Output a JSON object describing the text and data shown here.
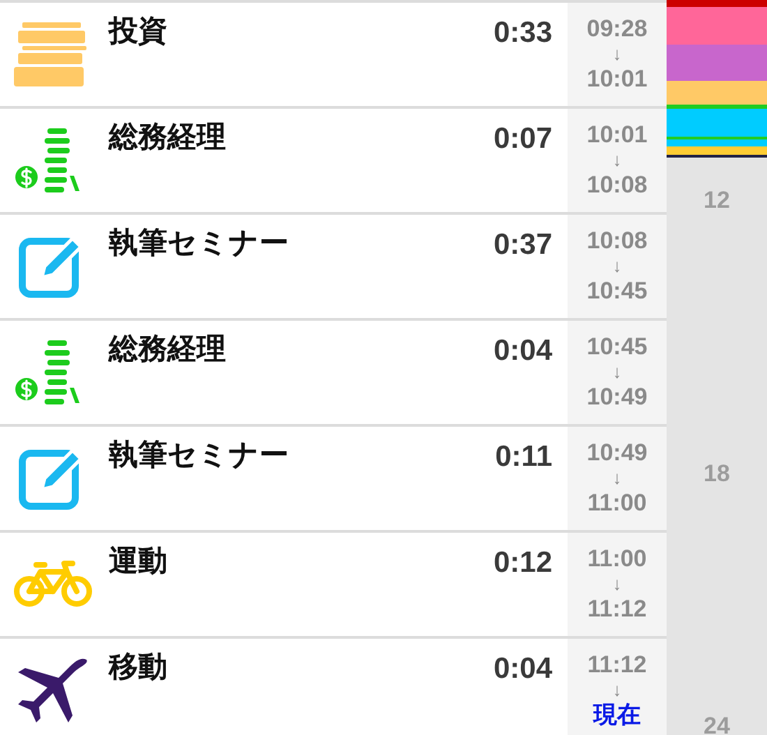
{
  "entries": [
    {
      "kind": "books",
      "color": "#ffc966",
      "name": "投資",
      "duration": "0:33",
      "start": "09:28",
      "arrow": "↓",
      "end": "10:01",
      "current": false
    },
    {
      "kind": "money",
      "color": "#1ccc1c",
      "name": "総務経理",
      "duration": "0:07",
      "start": "10:01",
      "arrow": "↓",
      "end": "10:08",
      "current": false
    },
    {
      "kind": "edit",
      "color": "#1ab8f0",
      "name": "執筆セミナー",
      "duration": "0:37",
      "start": "10:08",
      "arrow": "↓",
      "end": "10:45",
      "current": false
    },
    {
      "kind": "money",
      "color": "#1ccc1c",
      "name": "総務経理",
      "duration": "0:04",
      "start": "10:45",
      "arrow": "↓",
      "end": "10:49",
      "current": false
    },
    {
      "kind": "edit",
      "color": "#1ab8f0",
      "name": "執筆セミナー",
      "duration": "0:11",
      "start": "10:49",
      "arrow": "↓",
      "end": "11:00",
      "current": false
    },
    {
      "kind": "bike",
      "color": "#ffcc00",
      "name": "運動",
      "duration": "0:12",
      "start": "11:00",
      "arrow": "↓",
      "end": "11:12",
      "current": false
    },
    {
      "kind": "plane",
      "color": "#3a1a6a",
      "name": "移動",
      "duration": "0:04",
      "start": "11:12",
      "arrow": "↓",
      "end": "現在",
      "current": true
    }
  ],
  "timeline": {
    "segments": [
      {
        "color": "#cc0000"
      },
      {
        "color": "#ff6699"
      },
      {
        "color": "#c866cc"
      },
      {
        "color": "#ffc966"
      },
      {
        "color": "#22cc22"
      },
      {
        "color": "#00ccff"
      },
      {
        "color": "#22cc22"
      },
      {
        "color": "#00ccff"
      },
      {
        "color": "#ffcc33"
      },
      {
        "color": "#222244"
      }
    ],
    "hours": [
      "12",
      "18",
      "24"
    ]
  }
}
